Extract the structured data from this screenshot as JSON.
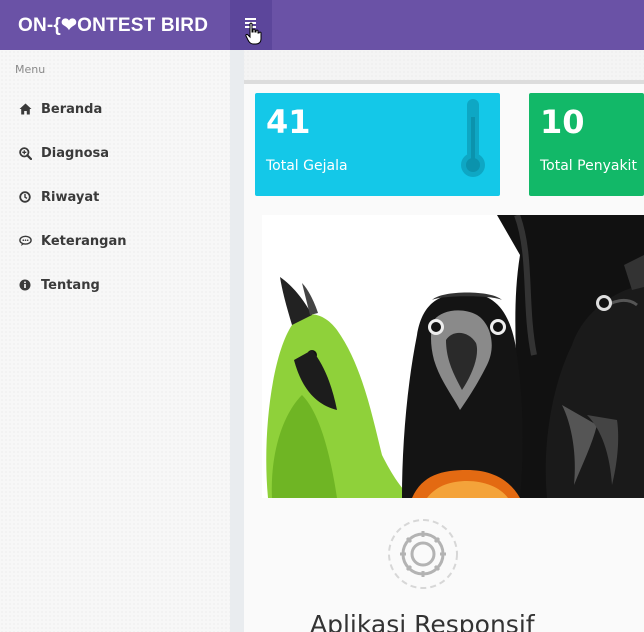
{
  "header": {
    "brand": "ON-{❤ONTEST BIRD",
    "menu_toggle_icon": "hamburger-icon"
  },
  "sidebar": {
    "title": "Menu",
    "items": [
      {
        "label": "Beranda",
        "icon": "home-icon"
      },
      {
        "label": "Diagnosa",
        "icon": "search-plus-icon"
      },
      {
        "label": "Riwayat",
        "icon": "clock-icon"
      },
      {
        "label": "Keterangan",
        "icon": "comment-icon"
      },
      {
        "label": "Tentang",
        "icon": "info-icon"
      }
    ]
  },
  "stats": [
    {
      "value": "41",
      "label": "Total Gejala",
      "icon": "thermometer-icon",
      "color": "#14c8e8"
    },
    {
      "value": "10",
      "label": "Total Penyakit",
      "color": "#12b868"
    }
  ],
  "feature": {
    "icon": "gear-icon",
    "title": "Aplikasi Responsif"
  },
  "colors": {
    "header": "#6a52a6",
    "toggle": "#5c469b"
  }
}
